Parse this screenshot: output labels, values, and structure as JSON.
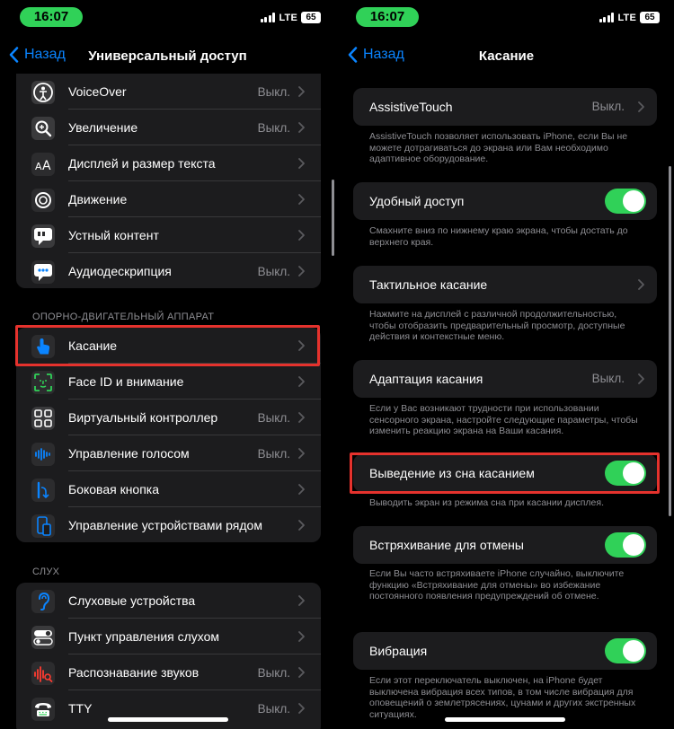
{
  "status": {
    "time": "16:07",
    "network": "LTE",
    "battery": "65"
  },
  "left": {
    "back_label": "Назад",
    "title": "Универсальный доступ",
    "group1": [
      {
        "label": "VoiceOver",
        "value": "Выкл.",
        "icon": "voiceover-icon",
        "color": "#1c1c1e"
      },
      {
        "label": "Увеличение",
        "value": "Выкл.",
        "icon": "magnifier-icon",
        "color": "#1c1c1e"
      },
      {
        "label": "Дисплей и размер текста",
        "value": "",
        "icon": "text-size-icon",
        "color": "#0a84ff"
      },
      {
        "label": "Движение",
        "value": "",
        "icon": "motion-icon",
        "color": "#30d158"
      },
      {
        "label": "Устный контент",
        "value": "",
        "icon": "speech-bubble-icon",
        "color": "#2c2c2e"
      },
      {
        "label": "Аудиодескрипция",
        "value": "Выкл.",
        "icon": "audio-description-icon",
        "color": "#0a84ff"
      }
    ],
    "section_motor": "ОПОРНО-ДВИГАТЕЛЬНЫЙ АППАРАТ",
    "group2": [
      {
        "label": "Касание",
        "value": "",
        "icon": "hand-touch-icon",
        "color": "#0a84ff"
      },
      {
        "label": "Face ID и внимание",
        "value": "",
        "icon": "face-id-icon",
        "color": "#30d158"
      },
      {
        "label": "Виртуальный контроллер",
        "value": "Выкл.",
        "icon": "grid-icon",
        "color": "#2c2c2e"
      },
      {
        "label": "Управление голосом",
        "value": "Выкл.",
        "icon": "voice-wave-icon",
        "color": "#0a84ff"
      },
      {
        "label": "Боковая кнопка",
        "value": "",
        "icon": "side-button-icon",
        "color": "#0a84ff"
      },
      {
        "label": "Управление устройствами рядом",
        "value": "",
        "icon": "nearby-devices-icon",
        "color": "#0a84ff"
      }
    ],
    "section_hearing": "СЛУХ",
    "group3": [
      {
        "label": "Слуховые устройства",
        "value": "",
        "icon": "ear-icon",
        "color": "#0a84ff"
      },
      {
        "label": "Пункт управления слухом",
        "value": "",
        "icon": "toggles-icon",
        "color": "#2c2c2e"
      },
      {
        "label": "Распознавание звуков",
        "value": "Выкл.",
        "icon": "sound-recognition-icon",
        "color": "#e5322d"
      },
      {
        "label": "TTY",
        "value": "Выкл.",
        "icon": "tty-icon",
        "color": "#30d158"
      }
    ]
  },
  "right": {
    "back_label": "Назад",
    "title": "Касание",
    "assistive_touch": {
      "label": "AssistiveTouch",
      "value": "Выкл.",
      "desc": "AssistiveTouch позволяет использовать iPhone, если Вы не можете дотрагиваться до экрана или Вам необходимо адаптивное оборудование."
    },
    "reachability": {
      "label": "Удобный доступ",
      "desc": "Смахните вниз по нижнему краю экрана, чтобы достать до верхнего края."
    },
    "haptic_touch": {
      "label": "Тактильное касание",
      "desc": "Нажмите на дисплей с различной продолжительностью, чтобы отобразить предварительный просмотр, доступные действия и контекстные меню."
    },
    "touch_accommodations": {
      "label": "Адаптация касания",
      "value": "Выкл.",
      "desc": "Если у Вас возникают трудности при использовании сенсорного экрана, настройте следующие параметры, чтобы изменить реакцию экрана на Ваши касания."
    },
    "tap_to_wake": {
      "label": "Выведение из сна касанием",
      "desc": "Выводить экран из режима сна при касании дисплея."
    },
    "shake_to_undo": {
      "label": "Встряхивание для отмены",
      "desc": "Если Вы часто встряхиваете iPhone случайно, выключите функцию «Встряхивание для отмены» во избежание постоянного появления предупреждений об отмене."
    },
    "vibration": {
      "label": "Вибрация",
      "desc": "Если этот переключатель выключен, на iPhone будет выключена вибрация всех типов, в том числе вибрация для оповещений о землетрясениях, цунами и других экстренных ситуациях."
    }
  }
}
